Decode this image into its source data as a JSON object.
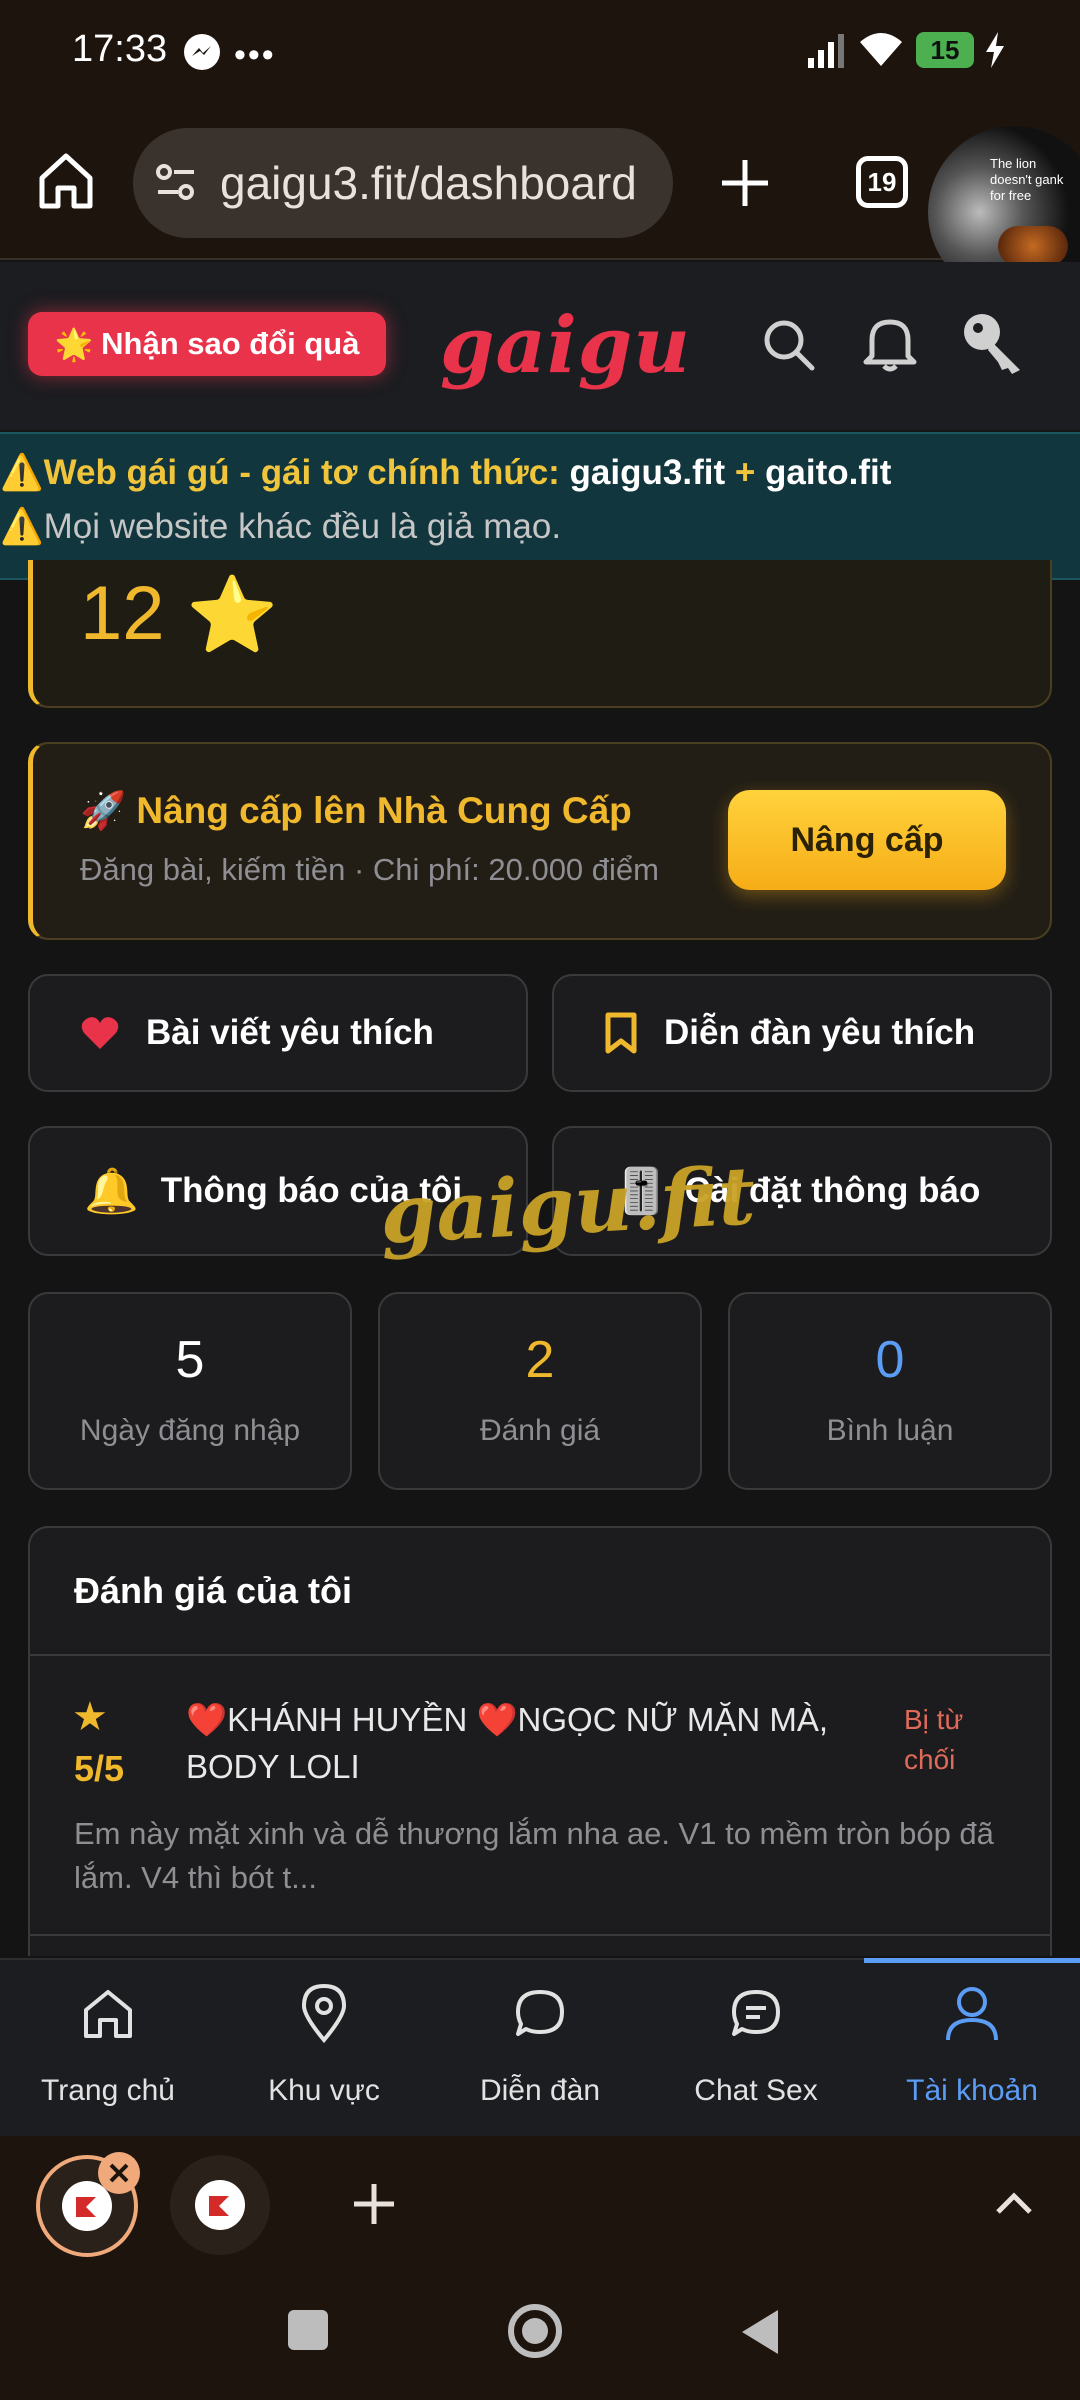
{
  "status_bar": {
    "time": "17:33",
    "battery": "15"
  },
  "browser": {
    "url": "gaigu3.fit/dashboard",
    "tab_count": "19",
    "thumbnail_text": "The lion doesn't gank for free"
  },
  "header": {
    "promo_label": "Nhận sao đổi quà",
    "promo_emoji": "🌟",
    "logo": "gaigu"
  },
  "notice": {
    "line1_prefix": "⚠️Web gái gú - gái tơ chính thức: ",
    "domain1": "gaigu3.fit",
    "plus": " + ",
    "domain2": "gaito.fit",
    "line2": "⚠️Mọi website khác đều là giả mạo."
  },
  "stars": {
    "value": "12",
    "icon": "⭐"
  },
  "upgrade": {
    "title": "🚀 Nâng cấp lên Nhà Cung Cấp",
    "subtitle": "Đăng bài, kiếm tiền · Chi phí: 20.000 điểm",
    "button": "Nâng cấp"
  },
  "quick_links": {
    "fav_posts": "Bài viết yêu thích",
    "fav_forums": "Diễn đàn yêu thích",
    "my_notifications": "Thông báo của tôi",
    "notification_settings": "Cài đặt thông báo",
    "bell_emoji": "🔔",
    "settings_emoji": "🎚️"
  },
  "watermark": "gaigu.fit",
  "stats": [
    {
      "value": "5",
      "label": "Ngày đăng nhập",
      "color": "#ffffff"
    },
    {
      "value": "2",
      "label": "Đánh giá",
      "color": "#f0b82c"
    },
    {
      "value": "0",
      "label": "Bình luận",
      "color": "#5b9df5"
    }
  ],
  "reviews": {
    "title": "Đánh giá của tôi",
    "items": [
      {
        "rating": "5/5",
        "star": "★",
        "name": "❤️KHÁNH HUYỀN ❤️NGỌC NỮ MẶN MÀ, BODY LOLI",
        "status": "Bị từ chối",
        "excerpt": "Em này mặt xinh và dễ thương lắm nha ae. V1 to mềm tròn bóp đã lắm. V4 thì bót t..."
      }
    ]
  },
  "bottom_nav": [
    {
      "label": "Trang chủ",
      "icon": "home-icon"
    },
    {
      "label": "Khu vực",
      "icon": "location-pin-icon"
    },
    {
      "label": "Diễn đàn",
      "icon": "chat-bubble-icon"
    },
    {
      "label": "Chat Sex",
      "icon": "chat-lines-icon"
    },
    {
      "label": "Tài khoản",
      "icon": "user-icon",
      "active": true
    }
  ],
  "colors": {
    "accent_red": "#e8334b",
    "gold": "#f0b82c",
    "blue": "#5b9df5",
    "rejected": "#e06a5a"
  }
}
